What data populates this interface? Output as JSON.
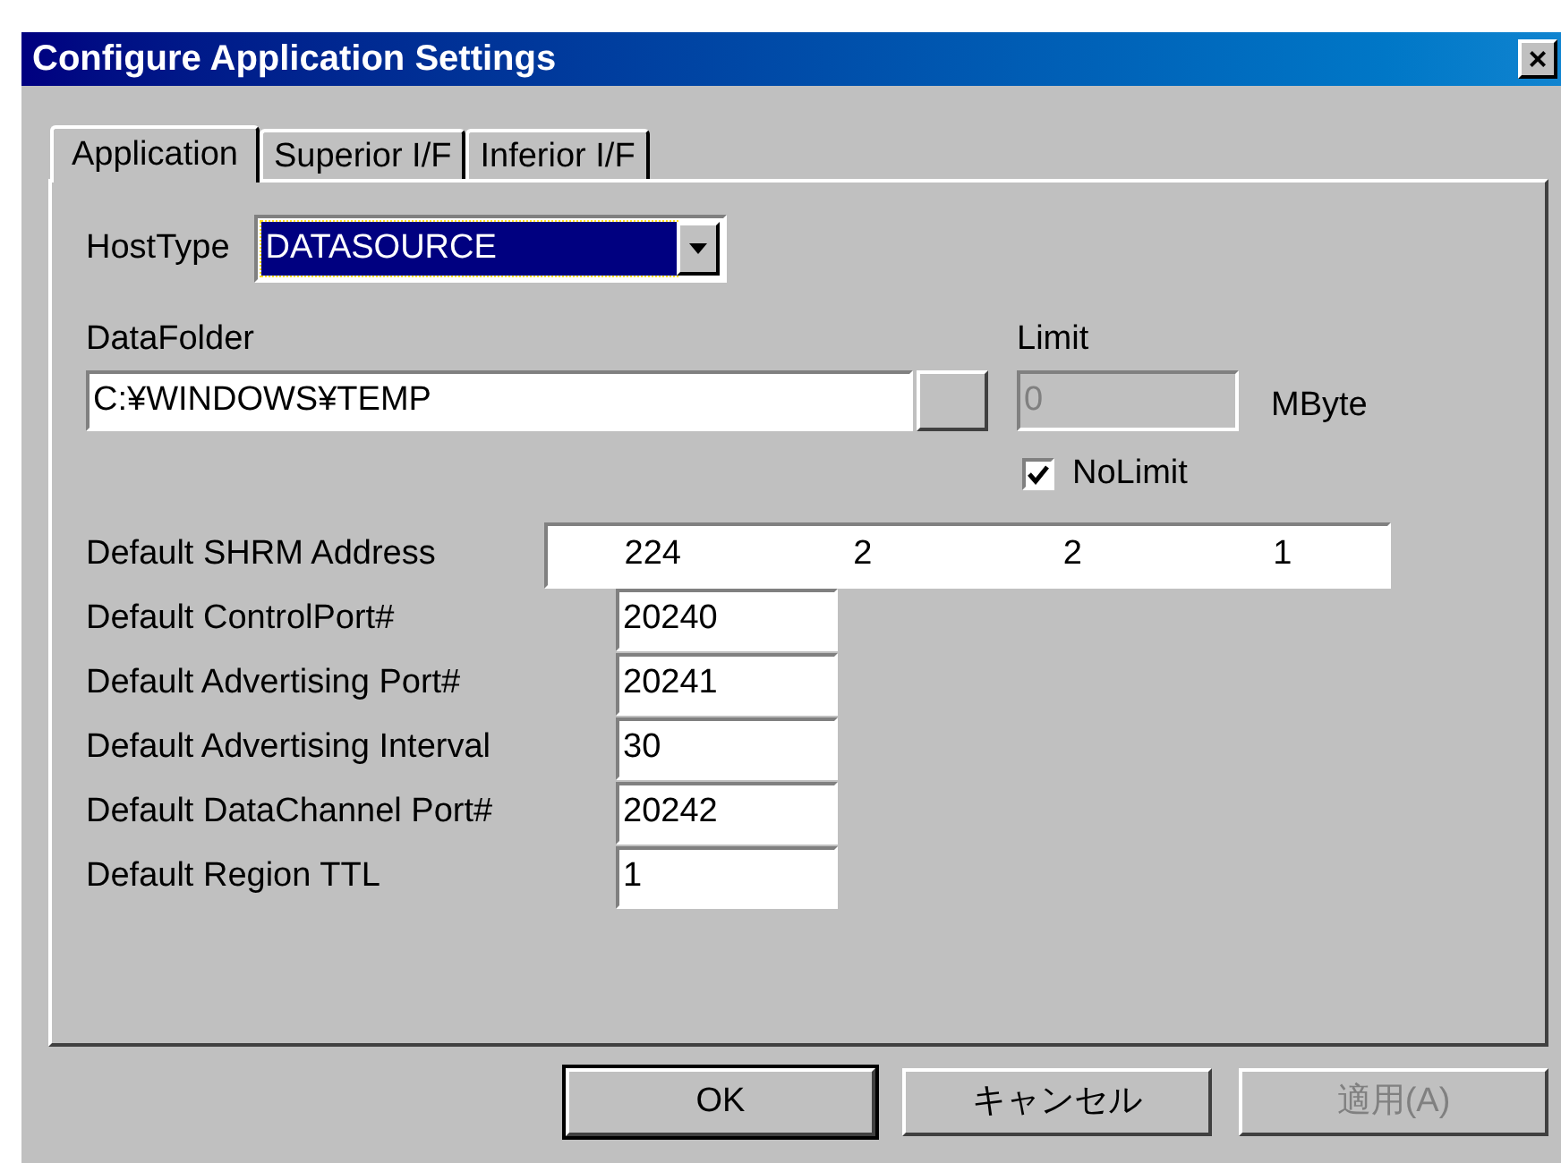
{
  "window": {
    "title": "Configure Application Settings",
    "close": "×"
  },
  "tabs": [
    {
      "label": "Application",
      "selected": true
    },
    {
      "label": "Superior I/F",
      "selected": false
    },
    {
      "label": "Inferior I/F",
      "selected": false
    }
  ],
  "host_type": {
    "label": "HostType",
    "value": "DATASOURCE",
    "focused": true
  },
  "data_folder": {
    "label": "DataFolder",
    "value": "C:¥WINDOWS¥TEMP"
  },
  "limit": {
    "label": "Limit",
    "value": "0",
    "unit": "MByte",
    "disabled": true
  },
  "no_limit": {
    "label": "NoLimit",
    "checked": true
  },
  "shrm_address": {
    "label": "Default SHRM Address",
    "octets": [
      "224",
      "2",
      "2",
      "1"
    ]
  },
  "fields": [
    {
      "label": "Default ControlPort#",
      "value": "20240"
    },
    {
      "label": "Default Advertising Port#",
      "value": "20241"
    },
    {
      "label": "Default Advertising Interval",
      "value": "30"
    },
    {
      "label": "Default DataChannel Port#",
      "value": "20242"
    },
    {
      "label": "Default Region TTL",
      "value": "1"
    }
  ],
  "buttons": [
    {
      "label": "OK",
      "default": true,
      "disabled": false
    },
    {
      "label": "キャンセル",
      "default": false,
      "disabled": false
    },
    {
      "label": "適用(A)",
      "default": false,
      "disabled": true
    }
  ]
}
